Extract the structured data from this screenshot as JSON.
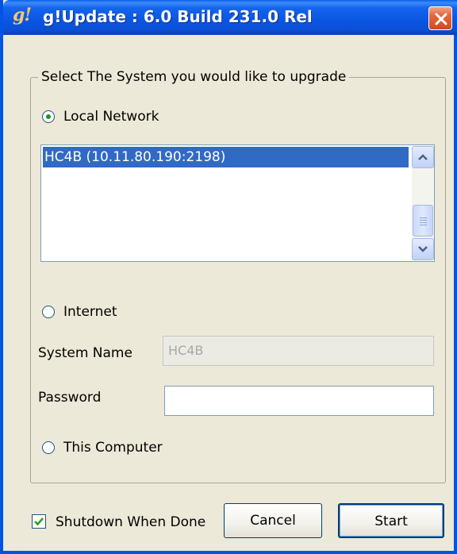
{
  "window": {
    "title": "g!Update : 6.0 Build 231.0 Rel",
    "app_icon_text": "g!"
  },
  "group": {
    "legend": "Select The System you would like to upgrade"
  },
  "options": {
    "local_network_label": "Local Network",
    "internet_label": "Internet",
    "this_computer_label": "This Computer",
    "selected": "Local Network"
  },
  "systems_list": {
    "items": [
      "HC4B (10.11.80.190:2198)"
    ],
    "selected_index": 0
  },
  "internet_fields": {
    "system_name_label": "System Name",
    "system_name_value": "HC4B",
    "password_label": "Password",
    "password_value": ""
  },
  "footer": {
    "shutdown_label": "Shutdown When Done",
    "shutdown_checked": true,
    "cancel_label": "Cancel",
    "start_label": "Start"
  },
  "colors": {
    "titlebar": "#0a55e1",
    "selection": "#316ac5",
    "window_bg": "#ece9d8"
  }
}
